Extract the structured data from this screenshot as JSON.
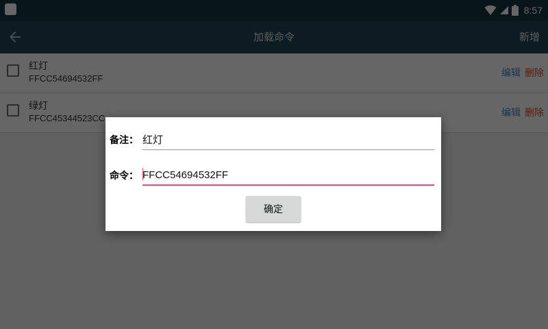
{
  "status_bar": {
    "time": "8:57",
    "icons": [
      "app-icon",
      "wifi-icon",
      "signal-icon",
      "battery-icon"
    ]
  },
  "toolbar": {
    "title": "加载命令",
    "action_label": "新增",
    "back_icon": "arrow-left-icon"
  },
  "list": {
    "items": [
      {
        "name": "红灯",
        "code": "FFCC54694532FF",
        "edit_label": "编辑",
        "delete_label": "删除"
      },
      {
        "name": "绿灯",
        "code": "FFCC45344523CC",
        "edit_label": "编辑",
        "delete_label": "删除"
      }
    ]
  },
  "dialog": {
    "note_label": "备注：",
    "note_value": "红灯",
    "command_label": "命令：",
    "command_value": "FFCC54694532FF",
    "confirm_label": "确定"
  },
  "colors": {
    "status_bar": "#163844",
    "toolbar": "#1f4755",
    "edit": "#2d8fd6",
    "delete": "#e04b23",
    "focus_underline": "#e84a7c"
  }
}
